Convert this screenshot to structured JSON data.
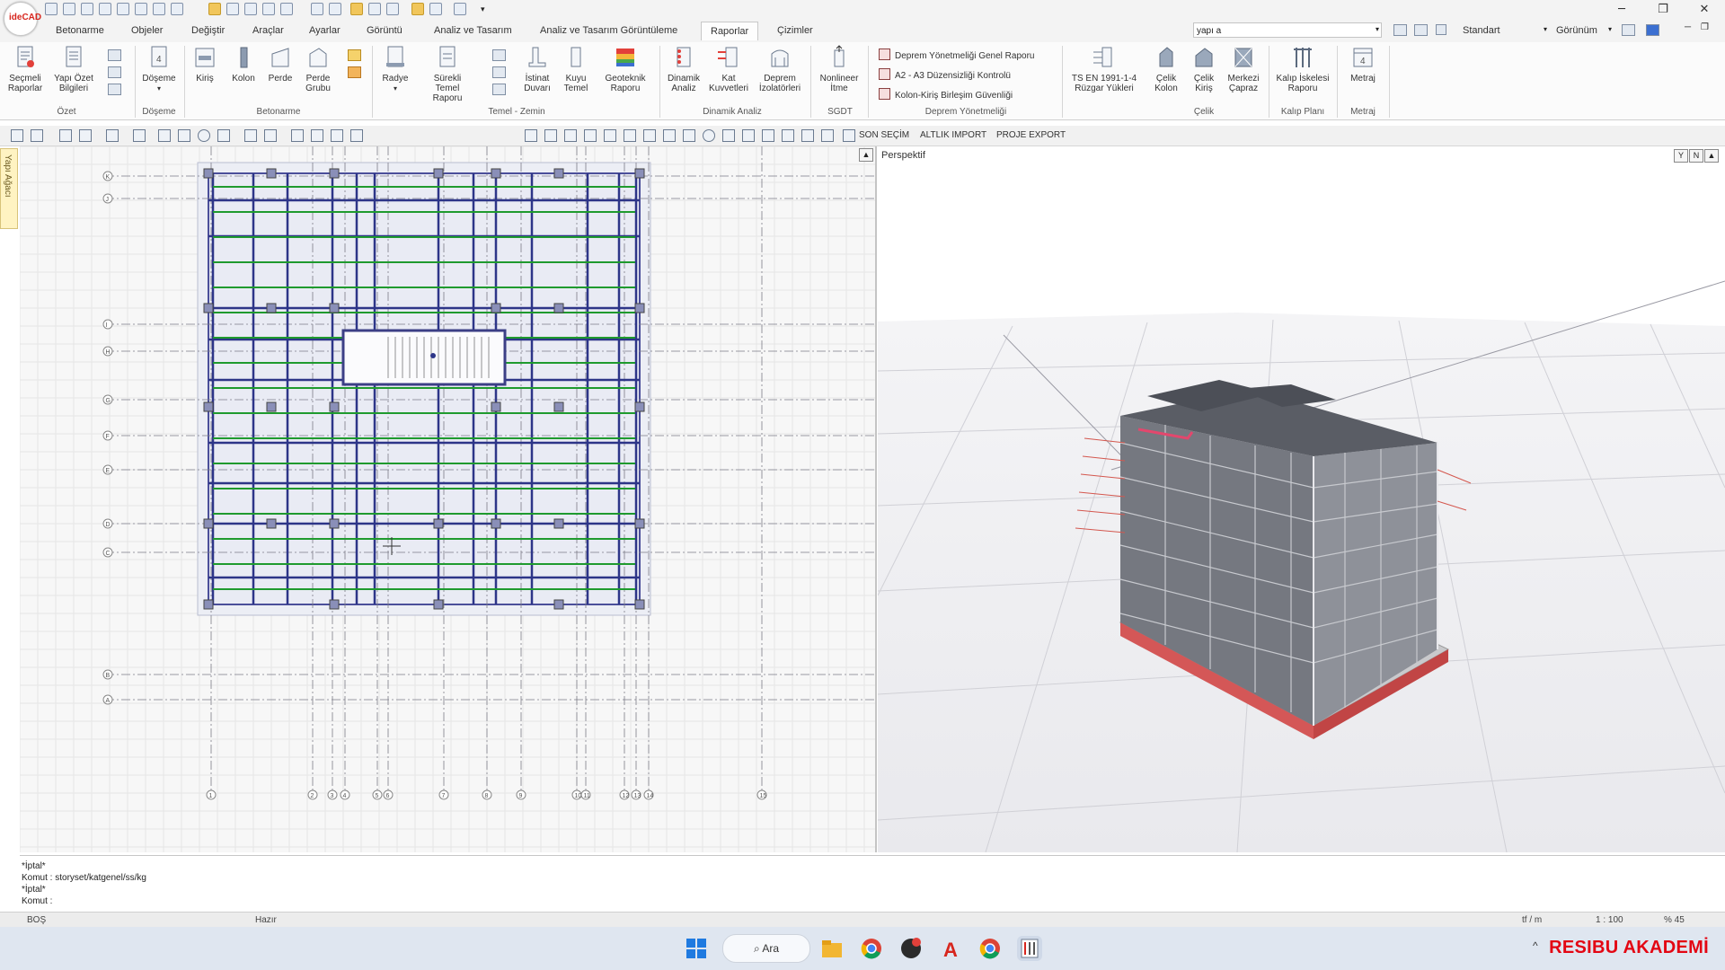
{
  "app": {
    "logo_text": "ideCAD"
  },
  "menu": {
    "tabs": [
      "Betonarme",
      "Objeler",
      "Değiştir",
      "Araçlar",
      "Ayarlar",
      "Görüntü",
      "Analiz ve Tasarım",
      "Analiz ve Tasarım Görüntüleme",
      "Raporlar",
      "Çizimler"
    ],
    "active": "Raporlar",
    "search_value": "yapı a",
    "style_value": "Standart",
    "view_label": "Görünüm"
  },
  "ribbon": {
    "buttons": {
      "secmeli": "Seçmeli Raporlar",
      "yapi_ozet": "Yapı Özet Bilgileri",
      "doseme": "Döşeme",
      "kiris": "Kiriş",
      "kolon": "Kolon",
      "perde": "Perde",
      "perde_grubu": "Perde Grubu",
      "radye": "Radye",
      "surekli_temel": "Sürekli Temel Raporu",
      "istinat": "İstinat Duvarı",
      "kuyu": "Kuyu Temel",
      "geoteknik": "Geoteknik Raporu",
      "dinamik": "Dinamik Analiz",
      "kat_kuvvet": "Kat Kuvvetleri",
      "deprem_izol": "Deprem İzolatörleri",
      "nonlineer": "Nonlineer İtme",
      "ts_en": "TS EN 1991-1-4 Rüzgar Yükleri",
      "celik_kolon": "Çelik Kolon",
      "celik_kiris": "Çelik Kiriş",
      "merkezi": "Merkezi Çapraz",
      "kalip": "Kalıp İskelesi Raporu",
      "metraj": "Metraj"
    },
    "deprem_items": [
      "Deprem Yönetmeliği Genel Raporu",
      "A2 - A3 Düzensizliği Kontrolü",
      "Kolon-Kiriş Birleşim Güvenliği"
    ],
    "groups": {
      "ozet": "Özet",
      "doseme": "Döşeme",
      "betonarme": "Betonarme",
      "temel": "Temel - Zemin",
      "dinamik": "Dinamik Analiz",
      "sgdt": "SGDT",
      "deprem": "Deprem Yönetmeliği",
      "celik": "Çelik",
      "kalip": "Kalıp Planı",
      "metraj": "Metraj"
    }
  },
  "toolbar": {
    "son_secim": "SON SEÇİM",
    "altlik_import": "ALTLIK IMPORT",
    "proje_export": "PROJE EXPORT"
  },
  "side": {
    "tab_label": "Yapı Ağacı"
  },
  "plan": {
    "axis_rows": [
      "K",
      "J",
      "I",
      "H",
      "G",
      "F",
      "E",
      "D",
      "C",
      "B",
      "A"
    ],
    "axis_cols": [
      "1",
      "2",
      "3",
      "4",
      "5",
      "6",
      "7",
      "8",
      "9",
      "10",
      "11",
      "12",
      "13",
      "14",
      "15"
    ]
  },
  "perspective": {
    "title": "Perspektif"
  },
  "command": {
    "lines": [
      "*İptal*",
      "Komut : storyset/katgenel/ss/kg",
      "*İptal*",
      "Komut :"
    ]
  },
  "status": {
    "left": "BOŞ",
    "state": "Hazır",
    "unit": "tf / m",
    "scale": "1 : 100",
    "zoom": "% 45"
  },
  "taskbar": {
    "search_label": "Ara",
    "brand": "RESIBU AKADEMİ"
  }
}
